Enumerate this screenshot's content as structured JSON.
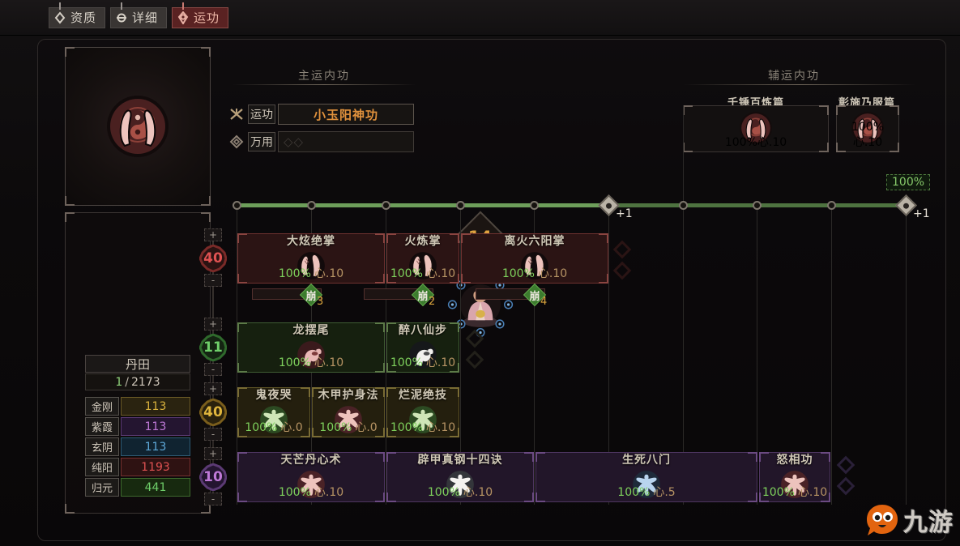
{
  "tabs": [
    {
      "label": "资质",
      "icon": "diamond-pin-icon",
      "active": false
    },
    {
      "label": "详细",
      "icon": "ring-pin-icon",
      "active": false
    },
    {
      "label": "运功",
      "icon": "circle-pin-icon",
      "active": true
    }
  ],
  "left": {
    "level": "14",
    "dantian_label": "丹田",
    "dantian_current": "1",
    "dantian_sep": "/",
    "dantian_max": "2173",
    "stats": [
      {
        "name": "金刚",
        "value": "113",
        "color": "#d8b13d",
        "bg": "#2a2310",
        "border": "#6b5a26"
      },
      {
        "name": "紫霞",
        "value": "113",
        "color": "#c07ad8",
        "bg": "#241530",
        "border": "#5b3a74"
      },
      {
        "name": "玄阴",
        "value": "113",
        "color": "#5ea8d8",
        "bg": "#102330",
        "border": "#2d5a74"
      },
      {
        "name": "纯阳",
        "value": "1193",
        "color": "#e05252",
        "bg": "#2e1212",
        "border": "#76302f"
      },
      {
        "name": "归元",
        "value": "441",
        "color": "#6fcf6a",
        "bg": "#17290f",
        "border": "#3e6a2d"
      }
    ]
  },
  "steppers": [
    {
      "value": "40",
      "plus": "+",
      "minus": "-",
      "color": "#e05252",
      "ring": "#7a2a28",
      "fill": "#2a1312"
    },
    {
      "value": "11",
      "plus": "+",
      "minus": "-",
      "color": "#6fcf6a",
      "ring": "#2f6a2c",
      "fill": "#142412"
    },
    {
      "value": "40",
      "plus": "+",
      "minus": "-",
      "color": "#e0b63d",
      "ring": "#7a5e1c",
      "fill": "#2a220d"
    },
    {
      "value": "10",
      "plus": "+",
      "minus": "-",
      "color": "#c07ad8",
      "ring": "#5b3a74",
      "fill": "#241530"
    }
  ],
  "main_section": {
    "title": "主运内功",
    "fields": [
      {
        "icon": "crossed-blades-icon",
        "label": "运功",
        "value": "小玉阳神功",
        "placeholder": ""
      },
      {
        "icon": "knot-icon",
        "label": "万用",
        "value": "",
        "placeholder": "◇◇"
      }
    ]
  },
  "aux_section": {
    "title": "辅运内功",
    "cards": [
      {
        "name": "千锤百炼篇",
        "pct": "100%",
        "lvl": "心.10",
        "icon": "praying-hands-icon"
      },
      {
        "name": "彰施乃服篇",
        "pct": "100%",
        "lvl": "心.10",
        "icon": "praying-hands-icon"
      }
    ]
  },
  "track": {
    "percent_badge": "100%",
    "handle_left_label": "+1",
    "handle_right_label": "+1"
  },
  "skill_rows": [
    {
      "theme": "red",
      "cards": [
        {
          "name": "大炫绝掌",
          "pct": "100%",
          "lvl": "心.10",
          "icon": "double-palm-icon",
          "badge": {
            "char": "崩",
            "num": "3"
          }
        },
        {
          "name": "火炼掌",
          "pct": "100%",
          "lvl": "心.10",
          "icon": "double-palm-icon",
          "badge": {
            "char": "崩",
            "num": "2"
          }
        },
        {
          "name": "离火六阳掌",
          "pct": "100%",
          "lvl": "心.10",
          "icon": "double-palm-icon",
          "badge": {
            "char": "崩",
            "num": "4"
          }
        }
      ]
    },
    {
      "theme": "green",
      "cards": [
        {
          "name": "龙摆尾",
          "pct": "100%",
          "lvl": "心.10",
          "icon": "kick-stance-icon"
        },
        {
          "name": "醉八仙步",
          "pct": "100%",
          "lvl": "心.10",
          "icon": "drunken-step-icon"
        }
      ]
    },
    {
      "theme": "olive",
      "cards": [
        {
          "name": "鬼夜哭",
          "pct": "100%",
          "lvl": "心.0",
          "icon": "body-aura-icon"
        },
        {
          "name": "木甲护身法",
          "pct": "100%",
          "lvl": "心.0",
          "icon": "body-aura-icon"
        },
        {
          "name": "烂泥绝技",
          "pct": "100%",
          "lvl": "心.10",
          "icon": "body-aura-icon"
        }
      ]
    },
    {
      "theme": "purple",
      "cards": [
        {
          "name": "天芒丹心术",
          "pct": "100%",
          "lvl": "心.10",
          "icon": "body-aura-icon"
        },
        {
          "name": "辟甲真钢十四诀",
          "pct": "100%",
          "lvl": "心.10",
          "icon": "body-aura-icon"
        },
        {
          "name": "生死八门",
          "pct": "100%",
          "lvl": "心.5",
          "icon": "body-aura-icon"
        },
        {
          "name": "怒相功",
          "pct": "100%",
          "lvl": "心.10",
          "icon": "body-aura-icon"
        }
      ]
    }
  ],
  "watermark": {
    "text": "九游",
    "icon": "jiuyou-blob-icon"
  }
}
